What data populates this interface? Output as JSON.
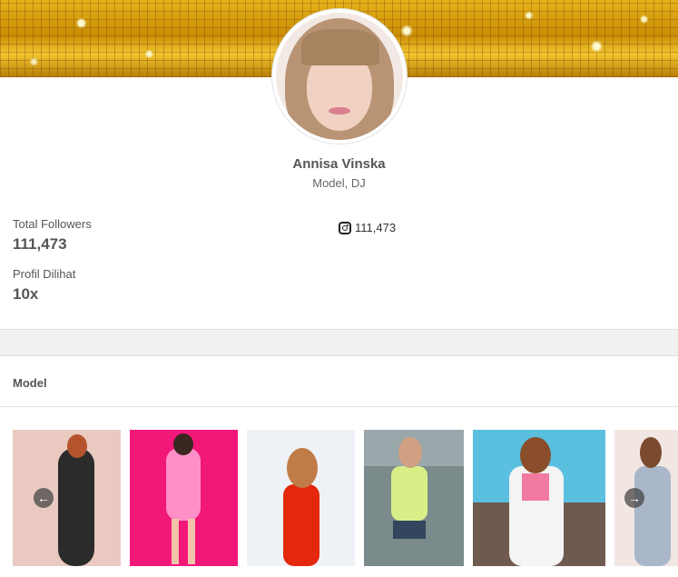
{
  "profile": {
    "name": "Annisa Vinska",
    "role": "Model, DJ"
  },
  "stats": {
    "followers_label": "Total Followers",
    "followers_value": "111,473",
    "views_label": "Profil Dilihat",
    "views_value": "10x"
  },
  "instagram": {
    "icon": "instagram-icon",
    "count": "111,473"
  },
  "section": {
    "title": "Model"
  },
  "gallery": {
    "prev_icon": "arrow-left-icon",
    "next_icon": "arrow-right-icon",
    "prev_glyph": "←",
    "next_glyph": "→",
    "photo_count": 6
  },
  "colors": {
    "banner_gold": "#d9a210",
    "text_muted": "#555555",
    "band": "#f1f1f1"
  }
}
